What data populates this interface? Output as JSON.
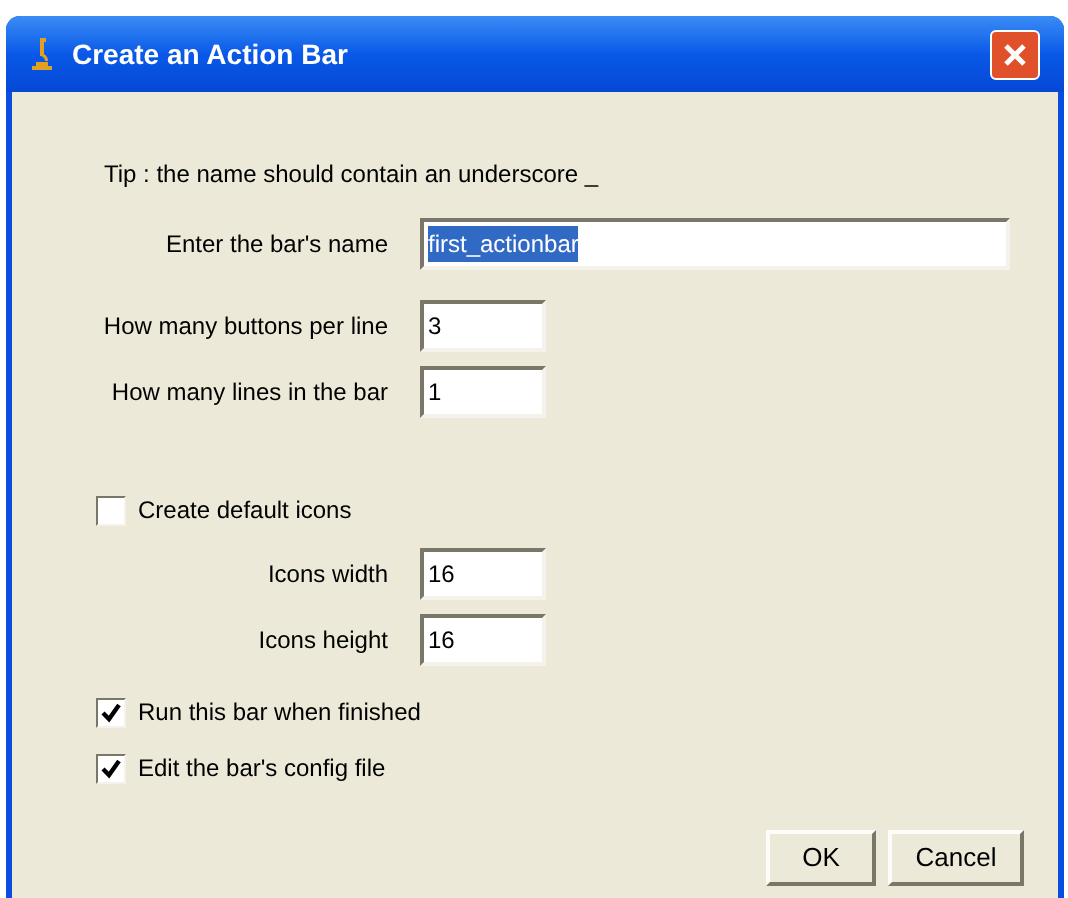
{
  "window": {
    "title": "Create an Action Bar"
  },
  "tip": "Tip : the name should contain an underscore _",
  "items": [
    {
      "kind": "field",
      "label": "Enter the bar's name",
      "value": "first_actionbar",
      "text_selected": true,
      "wide": true
    },
    {
      "kind": "field",
      "label": "How many buttons per line",
      "value": "3",
      "text_selected": false,
      "wide": false
    },
    {
      "kind": "field",
      "label": "How many lines in the bar",
      "value": "1",
      "text_selected": false,
      "wide": false
    },
    {
      "kind": "checkbox",
      "label": "Create default icons",
      "checked": false
    },
    {
      "kind": "field",
      "label": "Icons width",
      "value": "16",
      "text_selected": false,
      "wide": false
    },
    {
      "kind": "field",
      "label": "Icons height",
      "value": "16",
      "text_selected": false,
      "wide": false
    },
    {
      "kind": "checkbox",
      "label": "Run this bar when finished",
      "checked": true
    },
    {
      "kind": "checkbox",
      "label": "Edit the bar's config file",
      "checked": true
    }
  ],
  "buttons": [
    "OK",
    "Cancel"
  ]
}
